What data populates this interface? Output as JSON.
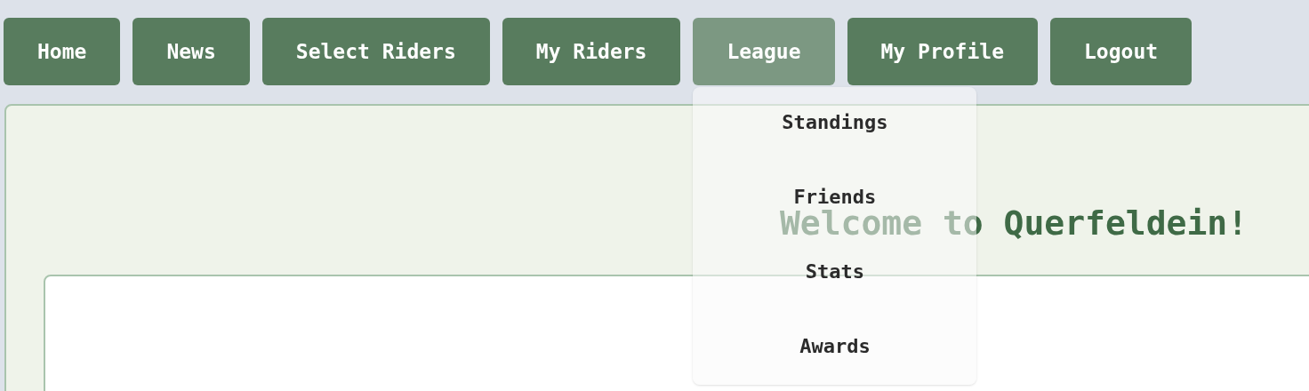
{
  "nav": [
    {
      "label": "Home",
      "expanded": false
    },
    {
      "label": "News",
      "expanded": false
    },
    {
      "label": "Select Riders",
      "expanded": false
    },
    {
      "label": "My Riders",
      "expanded": false
    },
    {
      "label": "League",
      "expanded": true,
      "children": [
        {
          "label": "Standings"
        },
        {
          "label": "Friends"
        },
        {
          "label": "Stats"
        },
        {
          "label": "Awards"
        }
      ]
    },
    {
      "label": "My Profile",
      "expanded": false
    },
    {
      "label": "Logout",
      "expanded": false
    }
  ],
  "main": {
    "title": "Welcome to Querfeldein!"
  }
}
